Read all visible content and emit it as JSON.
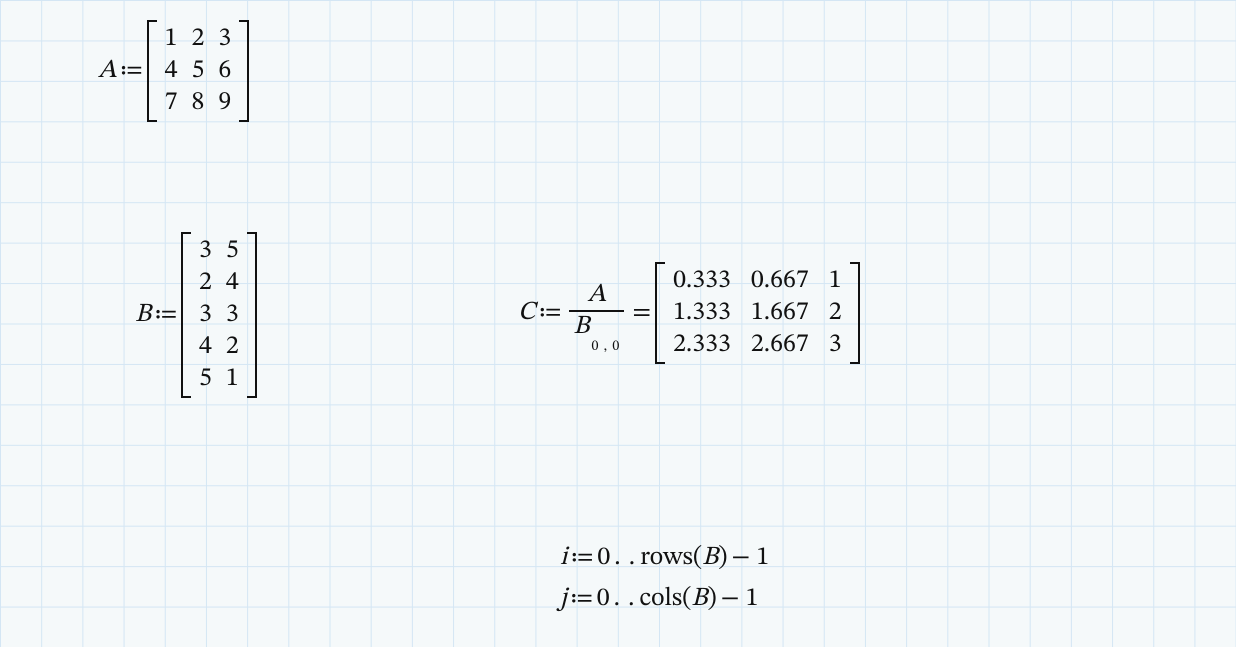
{
  "A": {
    "name": "A",
    "assign": "≔",
    "rows": [
      [
        "1",
        "2",
        "3"
      ],
      [
        "4",
        "5",
        "6"
      ],
      [
        "7",
        "8",
        "9"
      ]
    ]
  },
  "B": {
    "name": "B",
    "assign": "≔",
    "rows": [
      [
        "3",
        "5"
      ],
      [
        "2",
        "4"
      ],
      [
        "3",
        "3"
      ],
      [
        "4",
        "2"
      ],
      [
        "5",
        "1"
      ]
    ]
  },
  "C": {
    "name": "C",
    "assign": "≔",
    "frac": {
      "num": "A",
      "den_base": "B",
      "den_sub": "0 , 0"
    },
    "eq": "=",
    "result_rows": [
      [
        "0.333",
        "0.667",
        "1"
      ],
      [
        "1.333",
        "1.667",
        "2"
      ],
      [
        "2.333",
        "2.667",
        "3"
      ]
    ]
  },
  "ranges": {
    "i": {
      "var": "i",
      "assign": "≔",
      "start": "0",
      "dots": ". .",
      "fn": "rows",
      "arg": "B",
      "tail": "− 1"
    },
    "j": {
      "var": "j",
      "assign": "≔",
      "start": "0",
      "dots": ". .",
      "fn": "cols",
      "arg": "B",
      "tail": "− 1"
    }
  }
}
